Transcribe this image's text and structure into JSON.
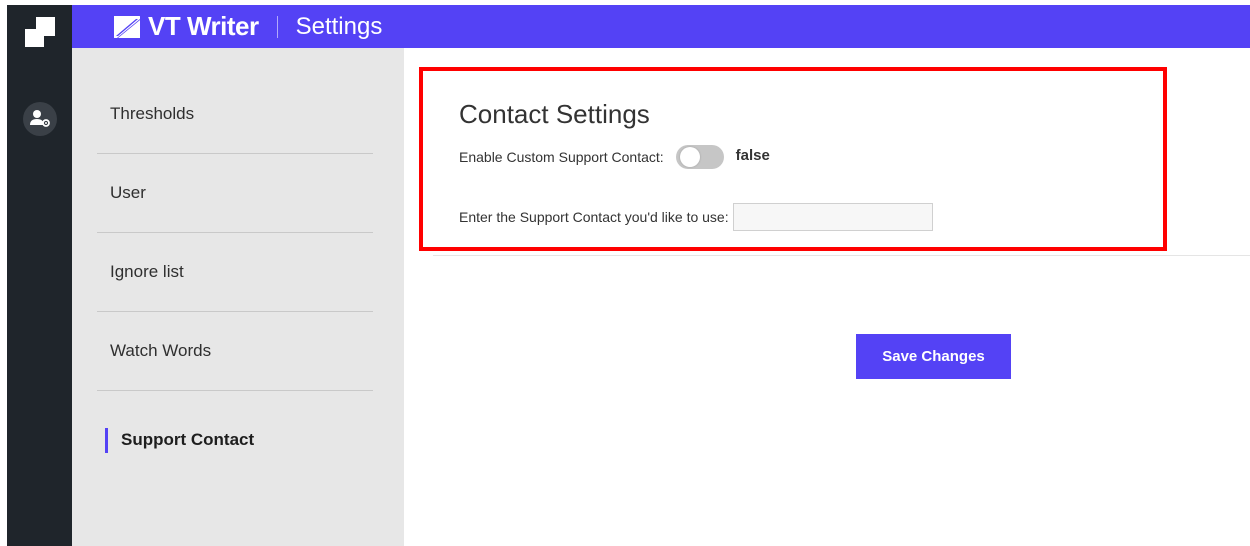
{
  "app": {
    "brand_name": "VT Writer",
    "page_title": "Settings",
    "accent_color": "#5442f5"
  },
  "rail": {
    "icons": [
      "app-logo-icon",
      "user-settings-icon"
    ]
  },
  "sidebar": {
    "items": [
      {
        "label": "Thresholds",
        "active": false
      },
      {
        "label": "User",
        "active": false
      },
      {
        "label": "Ignore list",
        "active": false
      },
      {
        "label": "Watch Words",
        "active": false
      },
      {
        "label": "Support Contact",
        "active": true
      }
    ]
  },
  "contact_settings": {
    "title": "Contact Settings",
    "toggle_label": "Enable Custom Support Contact:",
    "toggle_value": "false",
    "input_label": "Enter the Support Contact you'd like to use:",
    "input_value": ""
  },
  "actions": {
    "save_label": "Save Changes"
  },
  "highlight": {
    "color": "#ff0000"
  }
}
